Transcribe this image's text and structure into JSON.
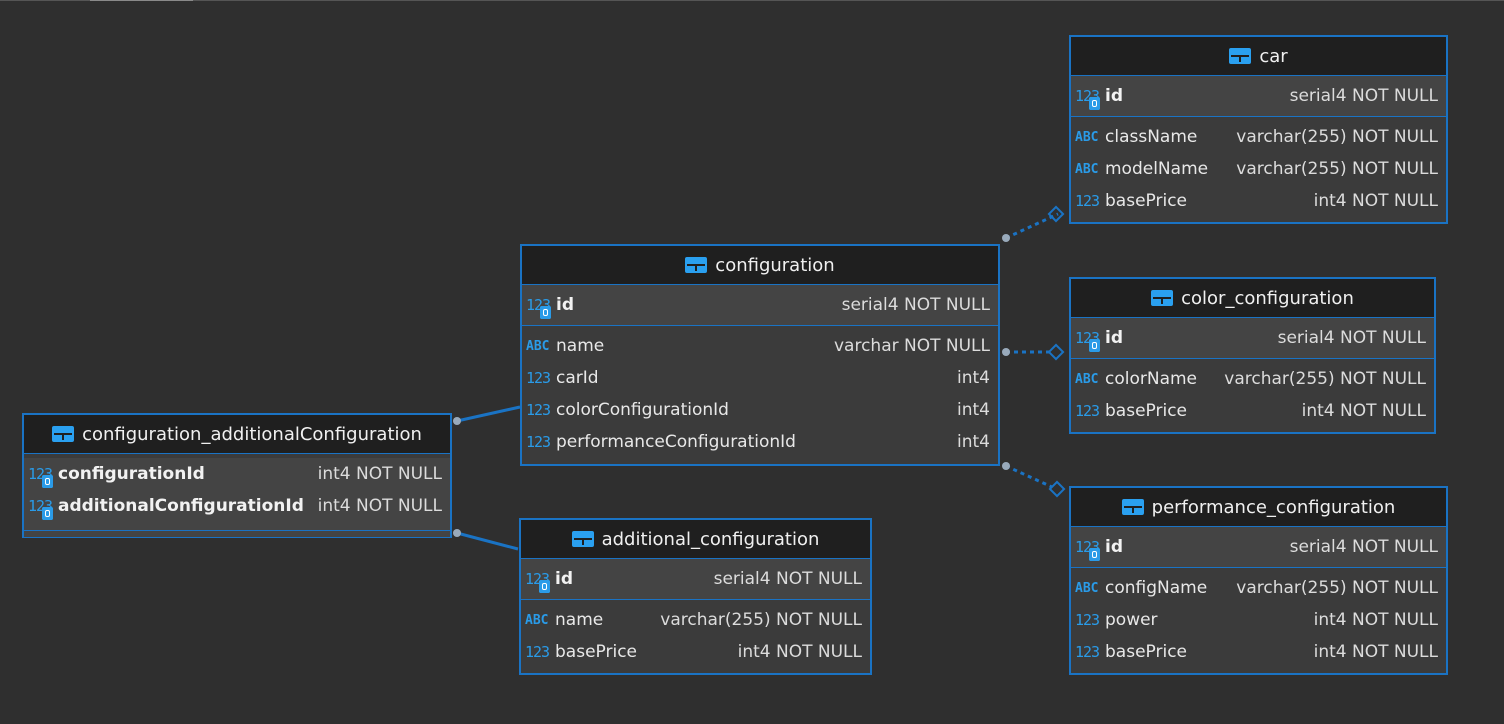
{
  "entities": {
    "car": {
      "title": "car",
      "pk": [
        {
          "name": "id",
          "type": "serial4 NOT NULL",
          "icon": "key-numeric-icon"
        }
      ],
      "attrs": [
        {
          "name": "className",
          "type": "varchar(255) NOT NULL",
          "icon": "abc-icon"
        },
        {
          "name": "modelName",
          "type": "varchar(255) NOT NULL",
          "icon": "abc-icon"
        },
        {
          "name": "basePrice",
          "type": "int4 NOT NULL",
          "icon": "numeric-icon"
        }
      ]
    },
    "configuration": {
      "title": "configuration",
      "pk": [
        {
          "name": "id",
          "type": "serial4 NOT NULL",
          "icon": "key-numeric-icon"
        }
      ],
      "attrs": [
        {
          "name": "name",
          "type": "varchar NOT NULL",
          "icon": "abc-icon"
        },
        {
          "name": "carId",
          "type": "int4",
          "icon": "numeric-icon"
        },
        {
          "name": "colorConfigurationId",
          "type": "int4",
          "icon": "numeric-icon"
        },
        {
          "name": "performanceConfigurationId",
          "type": "int4",
          "icon": "numeric-icon"
        }
      ]
    },
    "color_configuration": {
      "title": "color_configuration",
      "pk": [
        {
          "name": "id",
          "type": "serial4 NOT NULL",
          "icon": "key-numeric-icon"
        }
      ],
      "attrs": [
        {
          "name": "colorName",
          "type": "varchar(255) NOT NULL",
          "icon": "abc-icon"
        },
        {
          "name": "basePrice",
          "type": "int4 NOT NULL",
          "icon": "numeric-icon"
        }
      ]
    },
    "configuration_additionalConfiguration": {
      "title": "configuration_additionalConfiguration",
      "pk": [
        {
          "name": "configurationId",
          "type": "int4 NOT NULL",
          "icon": "key-numeric-icon"
        },
        {
          "name": "additionalConfigurationId",
          "type": "int4 NOT NULL",
          "icon": "key-numeric-icon"
        }
      ],
      "attrs": []
    },
    "additional_configuration": {
      "title": "additional_configuration",
      "pk": [
        {
          "name": "id",
          "type": "serial4 NOT NULL",
          "icon": "key-numeric-icon"
        }
      ],
      "attrs": [
        {
          "name": "name",
          "type": "varchar(255) NOT NULL",
          "icon": "abc-icon"
        },
        {
          "name": "basePrice",
          "type": "int4 NOT NULL",
          "icon": "numeric-icon"
        }
      ]
    },
    "performance_configuration": {
      "title": "performance_configuration",
      "pk": [
        {
          "name": "id",
          "type": "serial4 NOT NULL",
          "icon": "key-numeric-icon"
        }
      ],
      "attrs": [
        {
          "name": "configName",
          "type": "varchar(255) NOT NULL",
          "icon": "abc-icon"
        },
        {
          "name": "power",
          "type": "int4 NOT NULL",
          "icon": "numeric-icon"
        },
        {
          "name": "basePrice",
          "type": "int4 NOT NULL",
          "icon": "numeric-icon"
        }
      ]
    }
  },
  "icon_glyphs": {
    "numeric": "123",
    "abc": "ABC"
  },
  "colors": {
    "accent": "#1a73c4",
    "canvas": "#2f2f2f",
    "header": "#1f1f1f",
    "body": "#3b3b3b",
    "icon": "#2a9be8"
  }
}
